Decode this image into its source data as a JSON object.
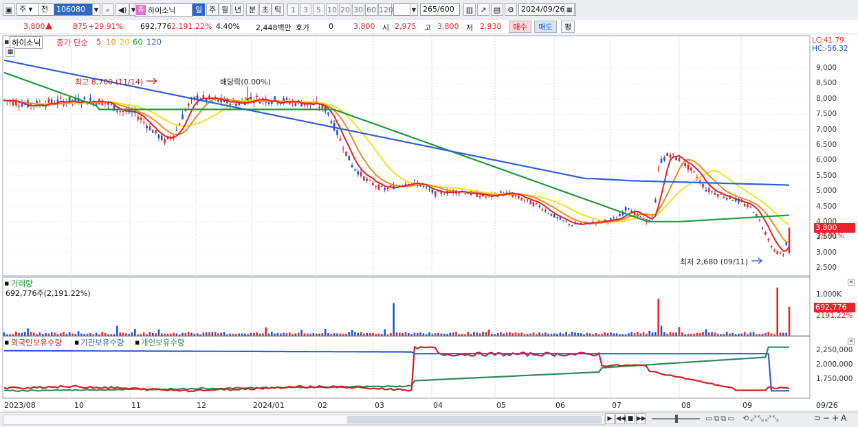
{
  "toolbar": {
    "mode1": "주",
    "mode2": "전",
    "code": "106080",
    "badge": "종",
    "name": "하이소닉",
    "periods": [
      "일",
      "주",
      "월",
      "년",
      "분",
      "초",
      "틱"
    ],
    "nums": [
      "1",
      "3",
      "5",
      "10",
      "20",
      "30",
      "60",
      "120"
    ],
    "count": "265",
    "count_total": "/600",
    "date": "2024/09/26"
  },
  "quote": {
    "price": "3,800",
    "up_arrow": "▲",
    "change": "875",
    "change_pct": "+29.91%",
    "volume": "692,776",
    "volume_pct": "2,191.22%",
    "turnover": "4.40%",
    "amount": "2,448백만",
    "hoga_label": "호가",
    "hoga": "0",
    "hoga_price": "3,800",
    "open_label": "시",
    "open": "2,975",
    "high_label": "고",
    "high": "3,800",
    "low_label": "저",
    "low": "2,930",
    "buy_label": "매수",
    "sell_label": "매도",
    "eval_label": "평"
  },
  "price_panel": {
    "name": "하이소닉",
    "ma_label": "종가 단순",
    "ma_periods": [
      "5",
      "10",
      "20",
      "60",
      "120"
    ],
    "lc": "LC:41.79",
    "hc": "HC:-56.32",
    "yticks": [
      "9,000",
      "8,500",
      "8,000",
      "7,500",
      "7,000",
      "6,500",
      "6,000",
      "5,500",
      "5,000",
      "4,500",
      "4,000",
      "3,500",
      "3,000",
      "2,500"
    ],
    "high_note": "최고 8,700 (11/14)",
    "dividend_note": "배당락(0.00%)",
    "low_note": "최저 2,680 (09/11)",
    "last_price": "3,800",
    "last_pct": "29.91%"
  },
  "volume_panel": {
    "title": "거래량",
    "value": "692,776주(2,191.22%)",
    "ytick": "1,000K",
    "last": "692,776",
    "last_pct": "2191.22%"
  },
  "holding_panel": {
    "labels": [
      "외국인보유수량",
      "기관보유수량",
      "개인보유수량"
    ],
    "yticks": [
      "2,250,000",
      "2,000,000",
      "1,750,000"
    ]
  },
  "xaxis": [
    "2023/08",
    "10",
    "11",
    "12",
    "2024/01",
    "02",
    "03",
    "04",
    "05",
    "06",
    "07",
    "08",
    "09",
    "09/26"
  ],
  "colors": {
    "up": "#e8262a",
    "down": "#1b54d8",
    "ma5": "#e22024",
    "ma10": "#f08a1c",
    "ma20": "#f5e21a",
    "ma60": "#1f9b3a",
    "ma120": "#2e5fd8",
    "foreign": "#d91c1c",
    "inst": "#2e5fd8",
    "indiv": "#2e8b57"
  }
}
